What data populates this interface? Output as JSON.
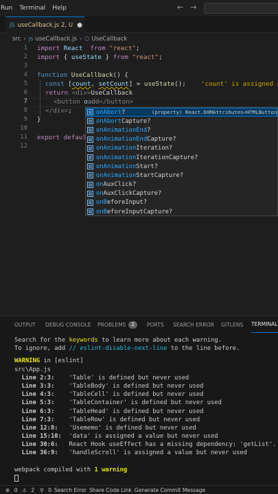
{
  "menubar": {
    "items": [
      "Run",
      "Terminal",
      "Help"
    ],
    "back_icon": "arrow-left-icon",
    "forward_icon": "arrow-right-icon"
  },
  "tab": {
    "filename": "useCallback.js",
    "meta": "2, U",
    "icon": "js-file-icon"
  },
  "breadcrumb": {
    "folder": "src",
    "file": "useCallback.js",
    "symbol": "UseCallback"
  },
  "editor": {
    "line_numbers": [
      "1",
      "2",
      "3",
      "4",
      "5",
      "6",
      "7",
      "8",
      "9",
      "10",
      "11",
      "12"
    ],
    "lines": {
      "l1": {
        "kw": "import",
        "name": " React ",
        "from": "from",
        "str": " \"react\"",
        "end": ";"
      },
      "l2": {
        "kw": "import",
        "open": " { ",
        "name": "useState",
        "close": " } ",
        "from": "from",
        "str": " \"react\"",
        "end": ";"
      },
      "l4": {
        "kw": "function",
        "name": " UseCallback",
        "rest": "() {"
      },
      "l5": {
        "kw": "const",
        "open": " [",
        "a": "count",
        "comma": ", ",
        "b": "setCount",
        "close": "] = ",
        "fn": "useState",
        "rest": "();",
        "diag": "'count' is assigned a v"
      },
      "l6": {
        "kw": "return",
        "tag": " <div>",
        "text": "UseCallback"
      },
      "l7": {
        "tag": "<button",
        "typed": " o",
        "ghost": "add",
        "tail": "</button>"
      },
      "l8": {
        "tag": "</div>",
        "rest": ";"
      },
      "l9": {
        "brace": "}"
      },
      "l11": {
        "kw": "export",
        "kw2": " defaul"
      }
    }
  },
  "suggestions": {
    "detail": "(property) React.DOMAttributes<HTMLButton",
    "items": [
      {
        "m": "onAbort",
        "rest": "?"
      },
      {
        "m": "onAbort",
        "rest": "Capture?"
      },
      {
        "m": "onAnimationEnd",
        "rest": "?"
      },
      {
        "m": "onAnimationEnd",
        "rest": "Capture?"
      },
      {
        "m": "onAnimation",
        "rest": "Iteration?"
      },
      {
        "m": "onAnimation",
        "rest": "IterationCapture?"
      },
      {
        "m": "onAnimation",
        "rest": "Start?"
      },
      {
        "m": "onAnimation",
        "rest": "StartCapture?"
      },
      {
        "m": "on",
        "rest": "AuxClick?"
      },
      {
        "m": "on",
        "rest": "AuxClickCapture?"
      },
      {
        "m": "onB",
        "rest": "eforeInput?"
      },
      {
        "m": "onB",
        "rest": "eforeInputCapture?"
      }
    ]
  },
  "panel": {
    "tabs": [
      "OUTPUT",
      "DEBUG CONSOLE",
      "PROBLEMS",
      "PORTS",
      "SEARCH ERROR",
      "GITLENS",
      "TERMINAL"
    ],
    "problems_count": "2"
  },
  "terminal": {
    "l1a": "Search for the ",
    "l1b": "keywords",
    "l1c": " to learn more about each warning.",
    "l2a": "To ignore, add ",
    "l2b": "// eslint-disable-next-line",
    "l2c": " to the line before.",
    "warn_label": "WARNING",
    "warn_rest": " in [eslint]",
    "file": "src\\App.js",
    "warnings": [
      {
        "loc": "  Line 2:3:",
        "msg": "    'Table' is defined but never used"
      },
      {
        "loc": "  Line 3:3:",
        "msg": "    'TableBody' is defined but never used"
      },
      {
        "loc": "  Line 4:3:",
        "msg": "    'TableCell' is defined but never used"
      },
      {
        "loc": "  Line 5:3:",
        "msg": "    'TableContainer' is defined but never used"
      },
      {
        "loc": "  Line 6:3:",
        "msg": "    'TableHead' is defined but never used"
      },
      {
        "loc": "  Line 7:3:",
        "msg": "    'TableRow' is defined but never used"
      },
      {
        "loc": "  Line 12:8:",
        "msg": "   'Usememo' is defined but never used"
      },
      {
        "loc": "  Line 15:10:",
        "msg": "  'data' is assigned a value but never used"
      },
      {
        "loc": "  Line 30:6:",
        "msg": "   React Hook useEffect has a missing dependency: 'getList'. Either"
      },
      {
        "loc": "  Line 36:9:",
        "msg": "   'handleScroll' is assigned a value but never used"
      }
    ],
    "compiled_a": "webpack compiled with ",
    "compiled_b": "1 warning"
  },
  "status": {
    "errors": "0",
    "warnings": "2",
    "ports": "0",
    "search_error": "Search Error",
    "share": "Share Code Link",
    "commit": "Generate Commit Message"
  },
  "colors": {
    "accent": "#0078d4",
    "warning": "#cca700",
    "suggest_match": "#2aaaff"
  }
}
